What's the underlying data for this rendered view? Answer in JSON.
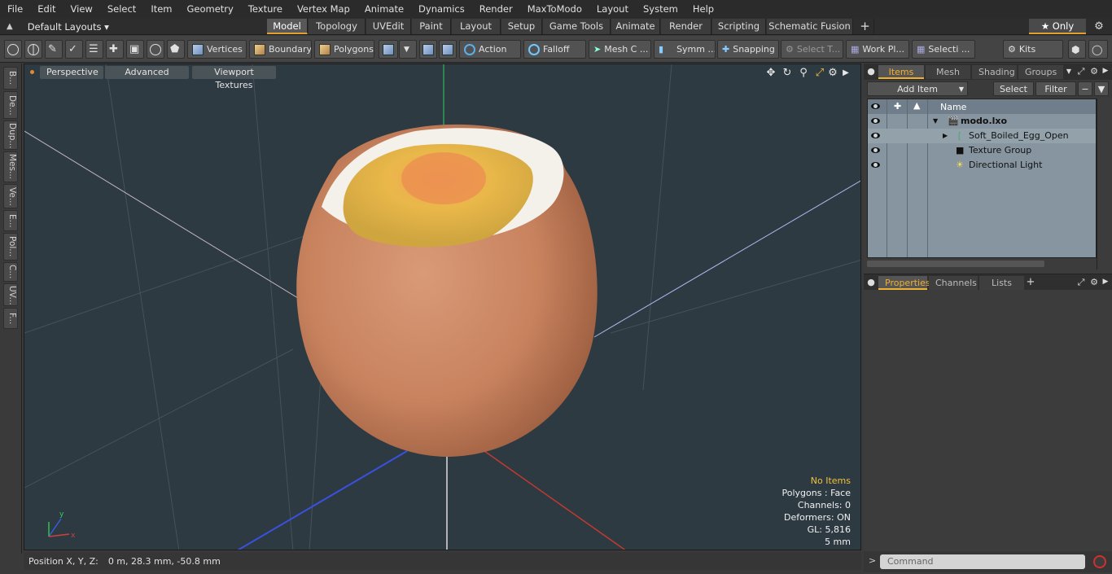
{
  "menubar": [
    "File",
    "Edit",
    "View",
    "Select",
    "Item",
    "Geometry",
    "Texture",
    "Vertex Map",
    "Animate",
    "Dynamics",
    "Render",
    "MaxToModo",
    "Layout",
    "System",
    "Help"
  ],
  "layout": {
    "dropdown": "Default Layouts ▾"
  },
  "tabs": [
    "Model",
    "Topology",
    "UVEdit",
    "Paint",
    "Layout",
    "Setup",
    "Game Tools",
    "Animate",
    "Render",
    "Scripting",
    "Schematic Fusion"
  ],
  "tab_plus": "+",
  "only": "★ Only",
  "toolbar": {
    "vertices": "Vertices",
    "boundary": "Boundary",
    "polygons": "Polygons",
    "action": "Action",
    "falloff": "Falloff",
    "mesh": "Mesh C ...",
    "symm": "Symm ...",
    "snapping": "Snapping",
    "select_t": "Select T...",
    "work_pl": "Work Pl...",
    "selecti": "Selecti ...",
    "kits": "Kits"
  },
  "leftstrip": [
    "B...",
    "De...",
    "Dup...",
    "Mes...",
    "Ve...",
    "E...",
    "Pol...",
    "C...",
    "UV...",
    "F..."
  ],
  "viewport": {
    "perspective": "Perspective",
    "advanced": "Advanced",
    "viewport_textures": "Viewport Textures",
    "info": {
      "no_items": "No Items",
      "polygons": "Polygons : Face",
      "channels": "Channels: 0",
      "deformers": "Deformers: ON",
      "gl": "GL: 5,816",
      "scale": "5 mm"
    },
    "axis_y": "y",
    "axis_x": "x"
  },
  "status": {
    "label": "Position X, Y, Z:",
    "value": "0 m, 28.3 mm, -50.8 mm"
  },
  "items_panel": {
    "tabs": [
      "Items",
      "Mesh ...",
      "Shading",
      "Groups"
    ],
    "add_item": "Add Item",
    "select": "Select",
    "filter": "Filter",
    "column_name": "Name",
    "tree": [
      {
        "name": "modo.lxo",
        "bold": true
      },
      {
        "name": "Soft_Boiled_Egg_Open"
      },
      {
        "name": "Texture Group"
      },
      {
        "name": "Directional Light"
      }
    ]
  },
  "props_panel": {
    "tabs": [
      "Properties",
      "Channels",
      "Lists"
    ],
    "plus": "+"
  },
  "command": {
    "placeholder": "Command",
    "arrow": ">"
  },
  "colors": {
    "accent": "#e0a030",
    "viewport_bg": "#2e3a42",
    "tree_bg": "#8795a0"
  }
}
